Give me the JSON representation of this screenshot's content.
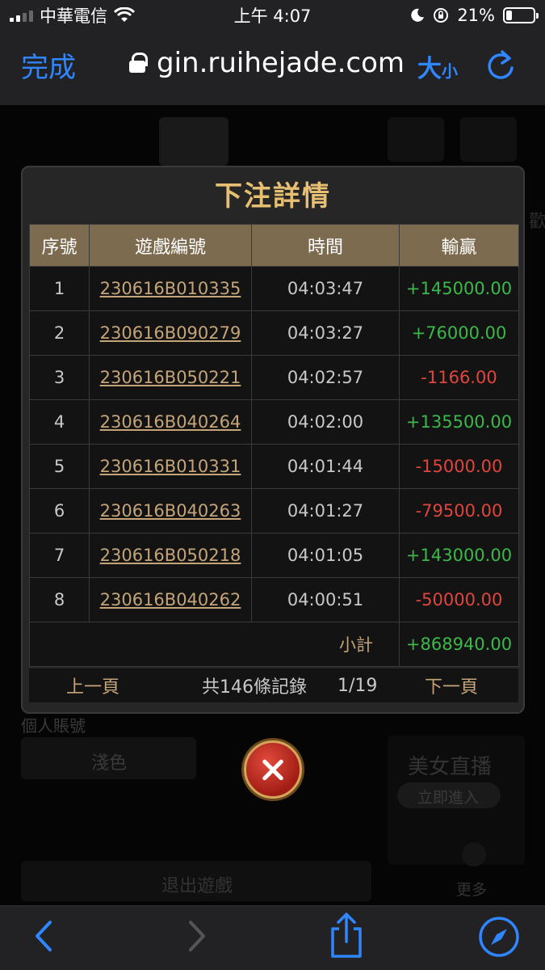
{
  "status_bar": {
    "carrier": "中華電信",
    "time": "上午 4:07",
    "battery": "21%",
    "battery_level": 0.21,
    "signal_level": 2
  },
  "url_bar": {
    "done_label": "完成",
    "url": "gin.ruihejade.com",
    "text_size_big": "大",
    "text_size_small": "小"
  },
  "background": {
    "section_label": "個人賬號",
    "light_color_button": "淺色",
    "live_title": "美女直播",
    "enter_now": "立即進入",
    "more": "更多",
    "exit_game": "退出遊戲",
    "partial_char": "歡"
  },
  "modal": {
    "title": "下注詳情",
    "columns": [
      "序號",
      "遊戲編號",
      "時間",
      "輸贏"
    ],
    "rows": [
      {
        "no": "1",
        "game_id": "230616B010335",
        "time": "04:03:47",
        "result": "+145000.00",
        "sign": "pos"
      },
      {
        "no": "2",
        "game_id": "230616B090279",
        "time": "04:03:27",
        "result": "+76000.00",
        "sign": "pos"
      },
      {
        "no": "3",
        "game_id": "230616B050221",
        "time": "04:02:57",
        "result": "-1166.00",
        "sign": "neg"
      },
      {
        "no": "4",
        "game_id": "230616B040264",
        "time": "04:02:00",
        "result": "+135500.00",
        "sign": "pos"
      },
      {
        "no": "5",
        "game_id": "230616B010331",
        "time": "04:01:44",
        "result": "-15000.00",
        "sign": "neg"
      },
      {
        "no": "6",
        "game_id": "230616B040263",
        "time": "04:01:27",
        "result": "-79500.00",
        "sign": "neg"
      },
      {
        "no": "7",
        "game_id": "230616B050218",
        "time": "04:01:05",
        "result": "+143000.00",
        "sign": "pos"
      },
      {
        "no": "8",
        "game_id": "230616B040262",
        "time": "04:00:51",
        "result": "-50000.00",
        "sign": "neg"
      }
    ],
    "subtotal_label": "小計",
    "subtotal_value": "+868940.00",
    "prev_label": "上一頁",
    "total_records": "共146條記錄",
    "page_indicator": "1/19",
    "next_label": "下一頁"
  },
  "colors": {
    "accent_gold": "#e6bf73",
    "positive": "#3bb84a",
    "negative": "#e0453d",
    "ios_blue": "#2f86ff"
  }
}
